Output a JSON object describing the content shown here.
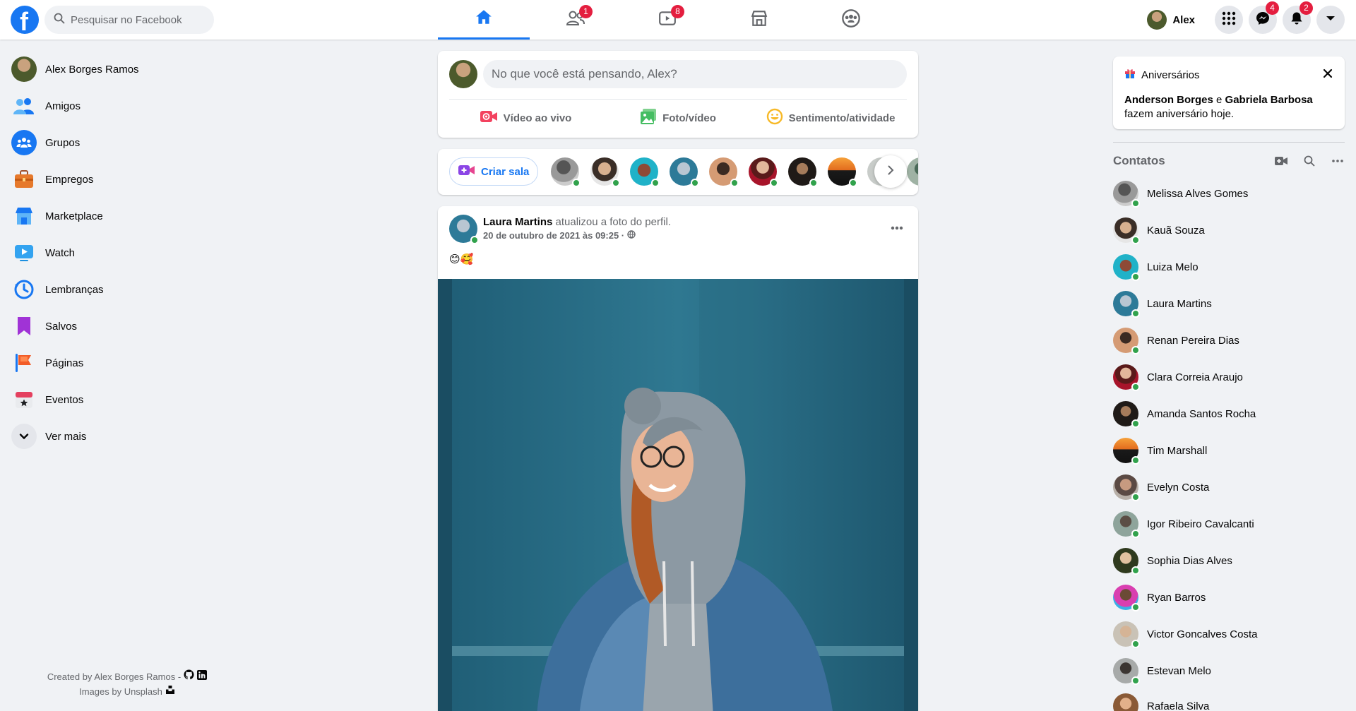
{
  "topbar": {
    "logo": "f",
    "search_placeholder": "Pesquisar no Facebook",
    "tabs": [
      {
        "name": "home",
        "icon": "home-icon",
        "badge": ""
      },
      {
        "name": "friends",
        "icon": "friends-icon",
        "badge": "1"
      },
      {
        "name": "watch",
        "icon": "video-icon",
        "badge": "8"
      },
      {
        "name": "marketplace",
        "icon": "store-icon",
        "badge": ""
      },
      {
        "name": "groups",
        "icon": "groups-icon",
        "badge": ""
      }
    ],
    "profile_name": "Alex",
    "messenger_badge": "4",
    "notifications_badge": "2"
  },
  "sidebar": {
    "items": [
      {
        "label": "Alex Borges Ramos",
        "icon": "avatar"
      },
      {
        "label": "Amigos",
        "icon": "friends-icon"
      },
      {
        "label": "Grupos",
        "icon": "groups-icon"
      },
      {
        "label": "Empregos",
        "icon": "briefcase-icon"
      },
      {
        "label": "Marketplace",
        "icon": "store-icon"
      },
      {
        "label": "Watch",
        "icon": "play-icon"
      },
      {
        "label": "Lembranças",
        "icon": "clock-icon"
      },
      {
        "label": "Salvos",
        "icon": "bookmark-icon"
      },
      {
        "label": "Páginas",
        "icon": "flag-icon"
      },
      {
        "label": "Eventos",
        "icon": "calendar-icon"
      },
      {
        "label": "Ver mais",
        "icon": "chevron-down-icon"
      }
    ],
    "credits": {
      "line1": "Created by Alex Borges Ramos -",
      "line2": "Images by Unsplash"
    }
  },
  "composer": {
    "placeholder": "No que você está pensando, Alex?",
    "live_label": "Vídeo ao vivo",
    "photo_label": "Foto/vídeo",
    "feeling_label": "Sentimento/atividade"
  },
  "rooms": {
    "create_label": "Criar sala"
  },
  "post": {
    "author": "Laura Martins",
    "action": " atualizou a foto do perfil.",
    "date": "20 de outubro de 2021 às 09:25 ·",
    "text": "😊🥰"
  },
  "birthdays": {
    "title": "Aniversários",
    "name1": "Anderson Borges",
    "conj": " e ",
    "name2": "Gabriela Barbosa",
    "suffix": "fazem aniversário hoje."
  },
  "contacts": {
    "title": "Contatos",
    "items": [
      {
        "name": "Melissa Alves Gomes"
      },
      {
        "name": "Kauã Souza"
      },
      {
        "name": "Luiza Melo"
      },
      {
        "name": "Laura Martins"
      },
      {
        "name": "Renan Pereira Dias"
      },
      {
        "name": "Clara Correia Araujo"
      },
      {
        "name": "Amanda Santos Rocha"
      },
      {
        "name": "Tim Marshall"
      },
      {
        "name": "Evelyn Costa"
      },
      {
        "name": "Igor Ribeiro Cavalcanti"
      },
      {
        "name": "Sophia Dias Alves"
      },
      {
        "name": "Ryan Barros"
      },
      {
        "name": "Victor Goncalves Costa"
      },
      {
        "name": "Estevan Melo"
      },
      {
        "name": "Rafaela Silva"
      }
    ]
  },
  "colors": {
    "brand": "#1877f2",
    "badge": "#e41e3f",
    "online": "#31a24c",
    "background": "#f0f2f5"
  }
}
